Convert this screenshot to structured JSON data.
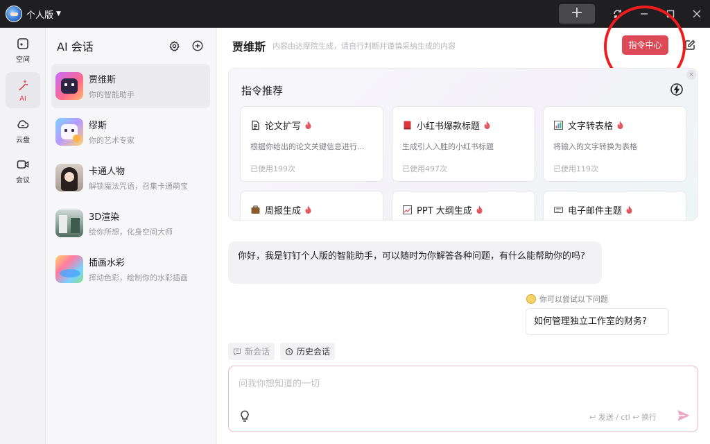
{
  "titlebar": {
    "account_label": "个人版",
    "new_tab_label": "+"
  },
  "rail": [
    {
      "label": "空间",
      "icon": "square-icon"
    },
    {
      "label": "AI",
      "icon": "magic-wand-icon"
    },
    {
      "label": "云盘",
      "icon": "cloud-icon"
    },
    {
      "label": "会议",
      "icon": "video-icon"
    }
  ],
  "sidebar": {
    "title": "AI 会话",
    "items": [
      {
        "name": "贾维斯",
        "desc": "你的智能助手"
      },
      {
        "name": "缪斯",
        "desc": "你的艺术专家"
      },
      {
        "name": "卡通人物",
        "desc": "解锁魔法咒语，召集卡通萌宝"
      },
      {
        "name": "3D渲染",
        "desc": "绘你所想，化身空间大师"
      },
      {
        "name": "插画水彩",
        "desc": "挥动色彩，绘制你的水彩插画"
      }
    ]
  },
  "main": {
    "title": "贾维斯",
    "subtitle": "内容由达摩院生成，请自行判断并谨慎采纳生成的内容",
    "command_center_label": "指令中心",
    "recommend": {
      "title": "指令推荐",
      "close_label": "×",
      "tiles": [
        {
          "name": "论文扩写",
          "desc": "根据你给出的论文关键信息进行...",
          "used": "已使用199次",
          "icon": "document-icon"
        },
        {
          "name": "小红书爆款标题",
          "desc": "生成引人入胜的小红书标题",
          "used": "已使用497次",
          "icon": "red-book-icon"
        },
        {
          "name": "文字转表格",
          "desc": "将输入的文字转换为表格",
          "used": "已使用119次",
          "icon": "bar-chart-icon"
        },
        {
          "name": "周报生成",
          "icon": "briefcase-icon"
        },
        {
          "name": "PPT 大纲生成",
          "icon": "trend-chart-icon"
        },
        {
          "name": "电子邮件主题",
          "icon": "email-icon"
        }
      ]
    },
    "greeting": "你好，我是钉钉个人版的智能助手，可以随时为你解答各种问题，有什么能帮助你的吗?",
    "try_label": "你可以尝试以下问题",
    "suggestion": "如何管理独立工作室的财务?",
    "new_chat_label": "新会话",
    "history_label": "历史会话",
    "input_placeholder": "问我你想知道的一切",
    "send_hint": "↩ 发送 / ctl ↩ 换行"
  },
  "colors": {
    "accent": "#dc4a57",
    "annotation_circle": "#ee1c1c",
    "fire": "#e0575f"
  }
}
